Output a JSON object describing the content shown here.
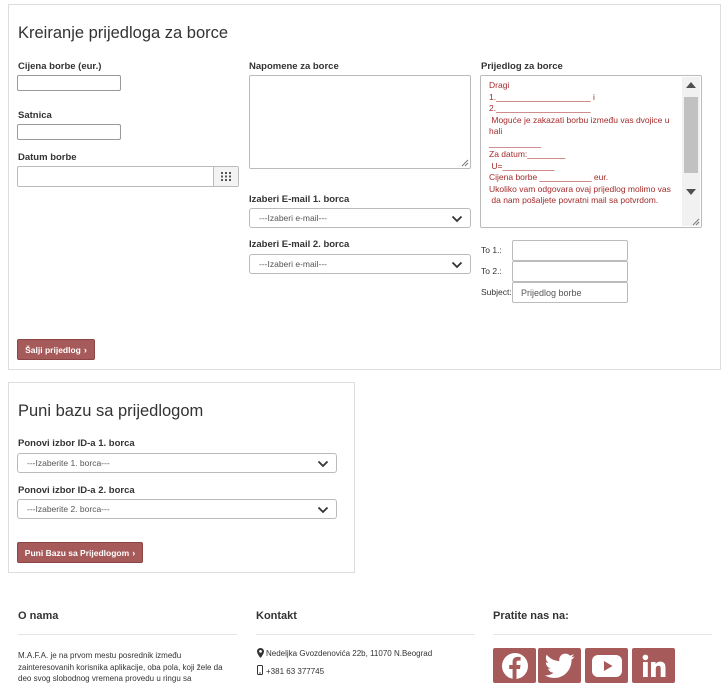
{
  "create_panel": {
    "title": "Kreiranje prijedloga za borce",
    "price_label": "Cijena borbe (eur.)",
    "price_value": "",
    "hourly_label": "Satnica",
    "hourly_value": "",
    "date_label": "Datum borbe",
    "date_value": "",
    "notes_label": "Napomene za borce",
    "email1_label": "Izaberi E-mail 1. borca",
    "email1_value": "---Izaberi e-mail---",
    "email2_label": "Izaberi E-mail 2. borca",
    "email2_value": "---Izaberi e-mail---",
    "proposal_label": "Prijedlog za borce",
    "proposal_text": "Dragi\n1.____________________ i\n2.____________________\n Moguće je zakazati borbu između vas dvojice u hali\n___________\nZa datum:________\n U=___________\nCijena borbe ___________ eur.\nUkoliko vam odgovara ovaj prijedlog molimo vas\n da nam pošaljete povratni mail sa potvrdom.",
    "to1_label": "To 1.:",
    "to1_value": "",
    "to2_label": "To 2.:",
    "to2_value": "",
    "subject_label": "Subject:",
    "subject_value": "Prijedlog borbe",
    "send_button": "Šalji prijedlog"
  },
  "db_panel": {
    "title": "Puni bazu sa prijedlogom",
    "id1_label": "Ponovi izbor ID-a 1. borca",
    "id1_value": "---Izaberite 1. borca---",
    "id2_label": "Ponovi izbor ID-a 2. borca",
    "id2_value": "---Izaberite 2. borca---",
    "fill_button": "Puni Bazu sa Prijedlogom"
  },
  "footer": {
    "about_title": "O nama",
    "about_text": "M.A.F.A. je na prvom mestu posrednik između zainteresovanih korisnika aplikacije, oba pola, koji žele da deo svog slobodnog vremena provedu u ringu sa",
    "contact_title": "Kontakt",
    "address": "Nedeljka Gvozdenovića 22b, 11070 N.Beograd",
    "phone": "+381 63 377745",
    "follow_title": "Pratite nas na:",
    "social": [
      "facebook-icon",
      "twitter-icon",
      "youtube-icon",
      "linkedin-icon"
    ]
  },
  "colors": {
    "accent": "#a65a5a",
    "proposal_text": "#a52a2a"
  }
}
